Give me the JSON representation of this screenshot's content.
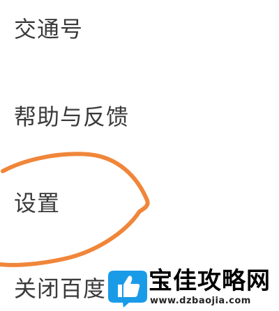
{
  "menu": {
    "items": [
      {
        "label": "交通号"
      },
      {
        "label": "帮助与反馈"
      },
      {
        "label": "设置"
      },
      {
        "label": "关闭百度"
      }
    ]
  },
  "annotation": {
    "color": "#f0863a",
    "shape": "hand-drawn ellipse highlighting 设置"
  },
  "watermark": {
    "title": "宝佳攻略网",
    "url": "www.dzbaojia.com",
    "logo_icon": "thumbs-up-icon",
    "logo_color": "#1a9be8"
  }
}
